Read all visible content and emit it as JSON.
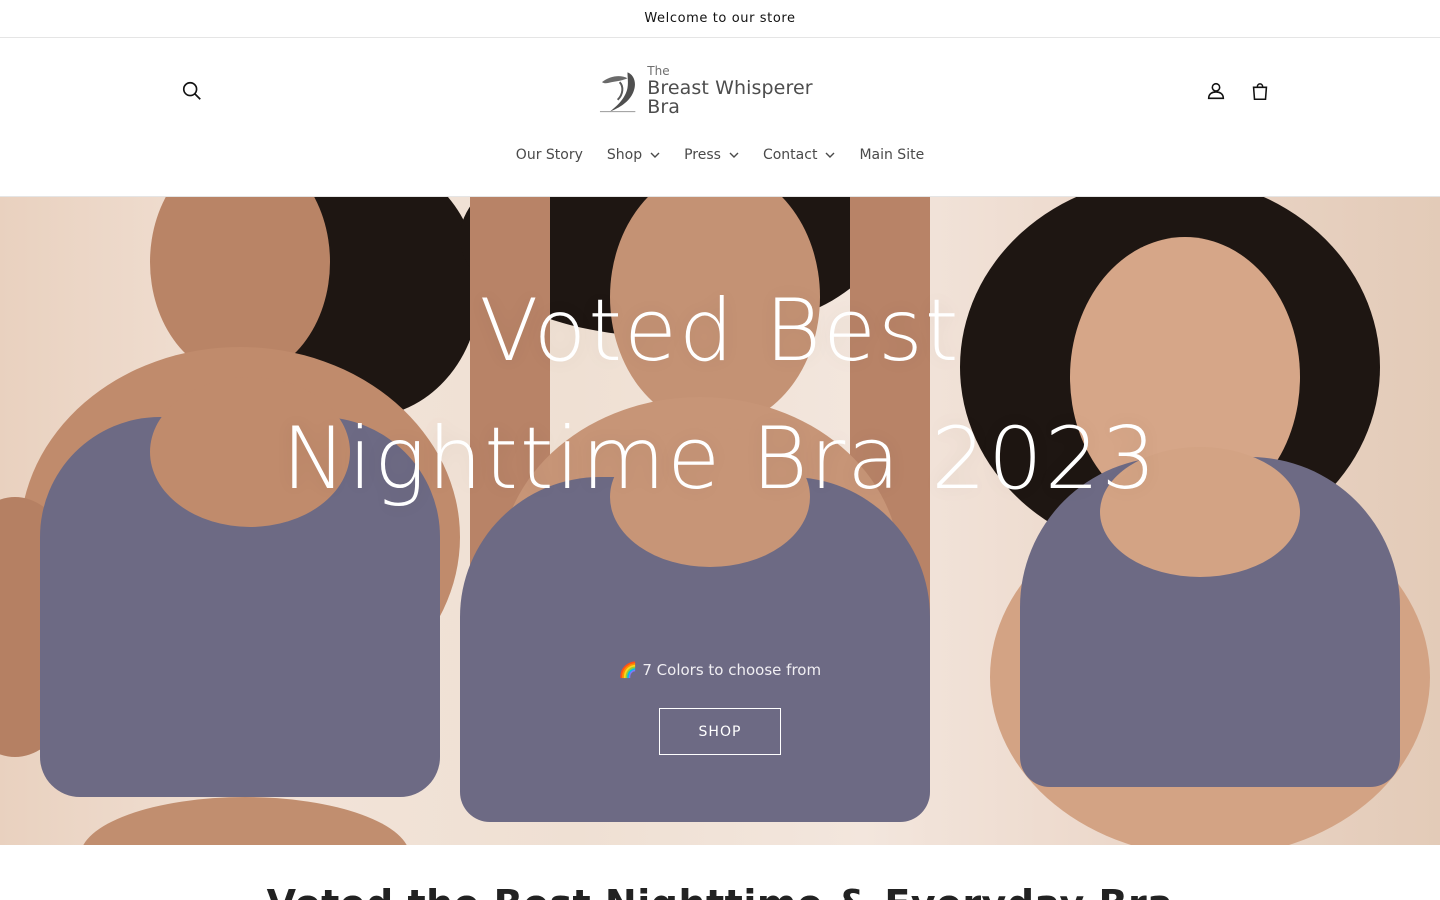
{
  "announcement": {
    "text": "Welcome to our store"
  },
  "header": {
    "logo": {
      "small": "The",
      "big": "Breast Whisperer Bra"
    },
    "icons": {
      "search": "search-icon",
      "account": "account-icon",
      "cart": "cart-icon"
    }
  },
  "nav": {
    "items": [
      {
        "label": "Our Story",
        "dropdown": false
      },
      {
        "label": "Shop",
        "dropdown": true
      },
      {
        "label": "Press",
        "dropdown": true
      },
      {
        "label": "Contact",
        "dropdown": true
      },
      {
        "label": "Main Site",
        "dropdown": false
      }
    ]
  },
  "hero": {
    "title_line1": "Voted Best",
    "title_line2": "Nighttime Bra 2023",
    "subtitle": "🌈 7 Colors to choose from",
    "button": "SHOP"
  },
  "section": {
    "heading": "Voted the Best Nighttime & Everyday Bra"
  },
  "colors": {
    "bra": "#6d6a84",
    "text": "#121212",
    "border": "#e5e5e5"
  }
}
